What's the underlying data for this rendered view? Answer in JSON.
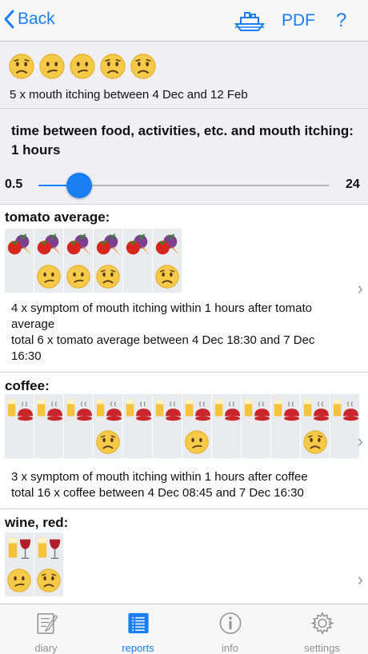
{
  "nav": {
    "back_label": "Back",
    "share_icon": "ship-icon",
    "pdf_label": "PDF",
    "help_label": "?"
  },
  "summary": {
    "faces": [
      "worried",
      "confused",
      "confused",
      "worried",
      "worried"
    ],
    "text": "5 x mouth itching between 4 Dec and 12 Feb"
  },
  "time": {
    "title": "time between food, activities, etc. and mouth itching: 1 hours",
    "min_label": "0.5",
    "max_label": "24",
    "value": 1
  },
  "sections": [
    {
      "title": "tomato average:",
      "item_icon": "tomato-icon",
      "cells": [
        "",
        "confused",
        "confused",
        "worried",
        "",
        "worried"
      ],
      "line1": "4 x  symptom of mouth itching within 1 hours after tomato average",
      "line2": "total 6 x tomato average between 4 Dec 18:30 and 7 Dec 16:30"
    },
    {
      "title": "coffee:",
      "item_icon": "coffee-icon",
      "cells": [
        "",
        "",
        "",
        "worried",
        "",
        "",
        "confused",
        "",
        "",
        "",
        "worried",
        ""
      ],
      "line1": "3 x  symptom of mouth itching within 1 hours after coffee",
      "line2": "total 16 x coffee between 4 Dec 08:45 and 7 Dec 16:30"
    },
    {
      "title": "wine, red:",
      "item_icon": "wine-icon",
      "cells": [
        "confused",
        "worried"
      ]
    }
  ],
  "tabs": [
    {
      "label": "diary",
      "icon": "diary-icon"
    },
    {
      "label": "reports",
      "icon": "reports-icon",
      "active": true
    },
    {
      "label": "info",
      "icon": "info-icon"
    },
    {
      "label": "settings",
      "icon": "settings-icon"
    }
  ],
  "colors": {
    "accent": "#1a7ef5",
    "face": "#f7c948",
    "background": "#efeff4"
  }
}
